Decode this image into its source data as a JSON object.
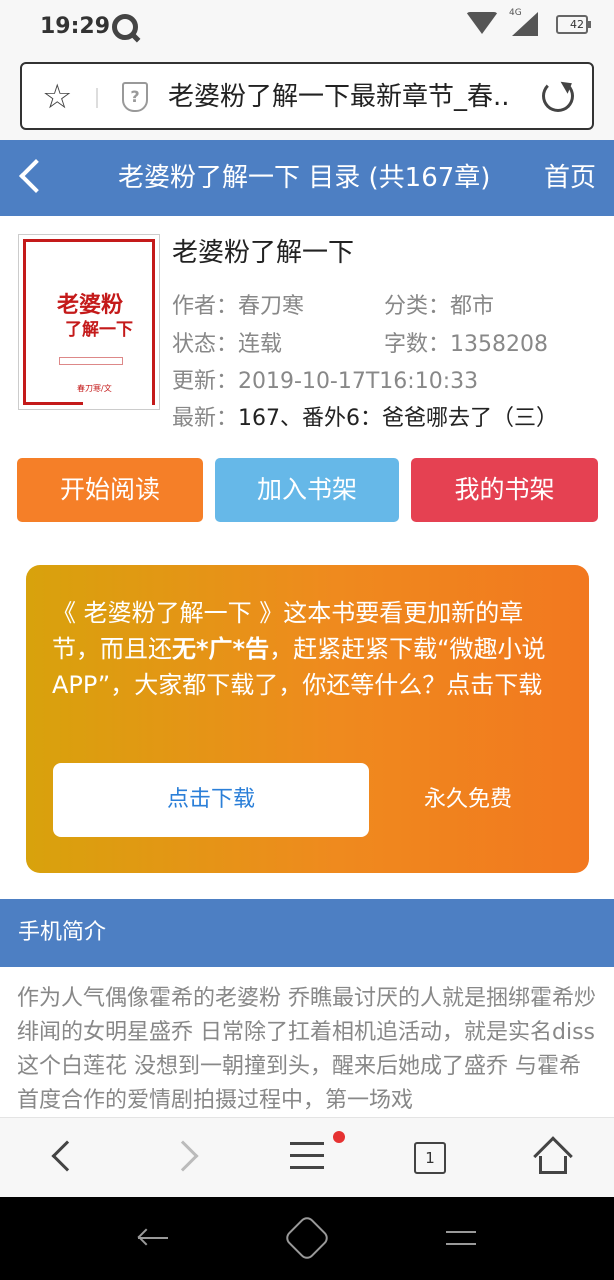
{
  "status_bar": {
    "time": "19:29",
    "network": "4G",
    "battery": "42",
    "icons": [
      "q-app-icon",
      "wifi-icon",
      "signal-icon",
      "battery-icon"
    ]
  },
  "browser": {
    "url_title": "老婆粉了解一下最新章节_春...",
    "shield_glyph": "?",
    "icons": [
      "star-icon",
      "shield-icon",
      "reload-icon"
    ]
  },
  "header": {
    "back_icon": "chevron-left-icon",
    "title": "老婆粉了解一下 目录 (共167章)",
    "home": "首页",
    "color": "#4d7fc3"
  },
  "book": {
    "cover": {
      "title_line1": "老婆粉",
      "title_line2": "了解一下",
      "author": "春刀寒/文"
    },
    "name": "老婆粉了解一下",
    "author_label": "作者：",
    "author": "春刀寒",
    "category_label": "分类：",
    "category": "都市",
    "status_label": "状态：",
    "status": "连载",
    "words_label": "字数：",
    "words": "1358208",
    "updated_label": "更新：",
    "updated": "2019-10-17T16:10:33",
    "latest_label": "最新：",
    "latest": "167、番外6：爸爸哪去了（三）"
  },
  "actions": {
    "start_reading": "开始阅读",
    "add_shelf": "加入书架",
    "my_shelf": "我的书架",
    "colors": {
      "start_reading": "#f57f28",
      "add_shelf": "#66b8e8",
      "my_shelf": "#e54152"
    }
  },
  "promo": {
    "text_before": "《 老婆粉了解一下 》这本书要看更加新的章节，而且还",
    "text_bold": "无*广*告",
    "text_after": "，赶紧赶紧下载“微趣小说APP”，大家都下载了，你还等什么？点击下载",
    "download_button": "点击下载",
    "free_label": "永久免费"
  },
  "intro": {
    "title": "手机简介",
    "body": "作为人气偶像霍希的老婆粉 乔瞧最讨厌的人就是捆绑霍希炒绯闻的女明星盛乔 日常除了扛着相机追活动，就是实名diss这个白莲花 没想到一朝撞到头，醒来后她成了盛乔 与霍希首度合作的爱情剧拍摄过程中，第一场戏"
  },
  "toolbar": {
    "tab_count": "1",
    "icons": [
      "back-icon",
      "forward-icon",
      "menu-icon",
      "tabs-icon",
      "home-icon"
    ]
  },
  "system_nav": {
    "icons": [
      "nav-back-icon",
      "nav-home-icon",
      "nav-recent-icon"
    ]
  }
}
